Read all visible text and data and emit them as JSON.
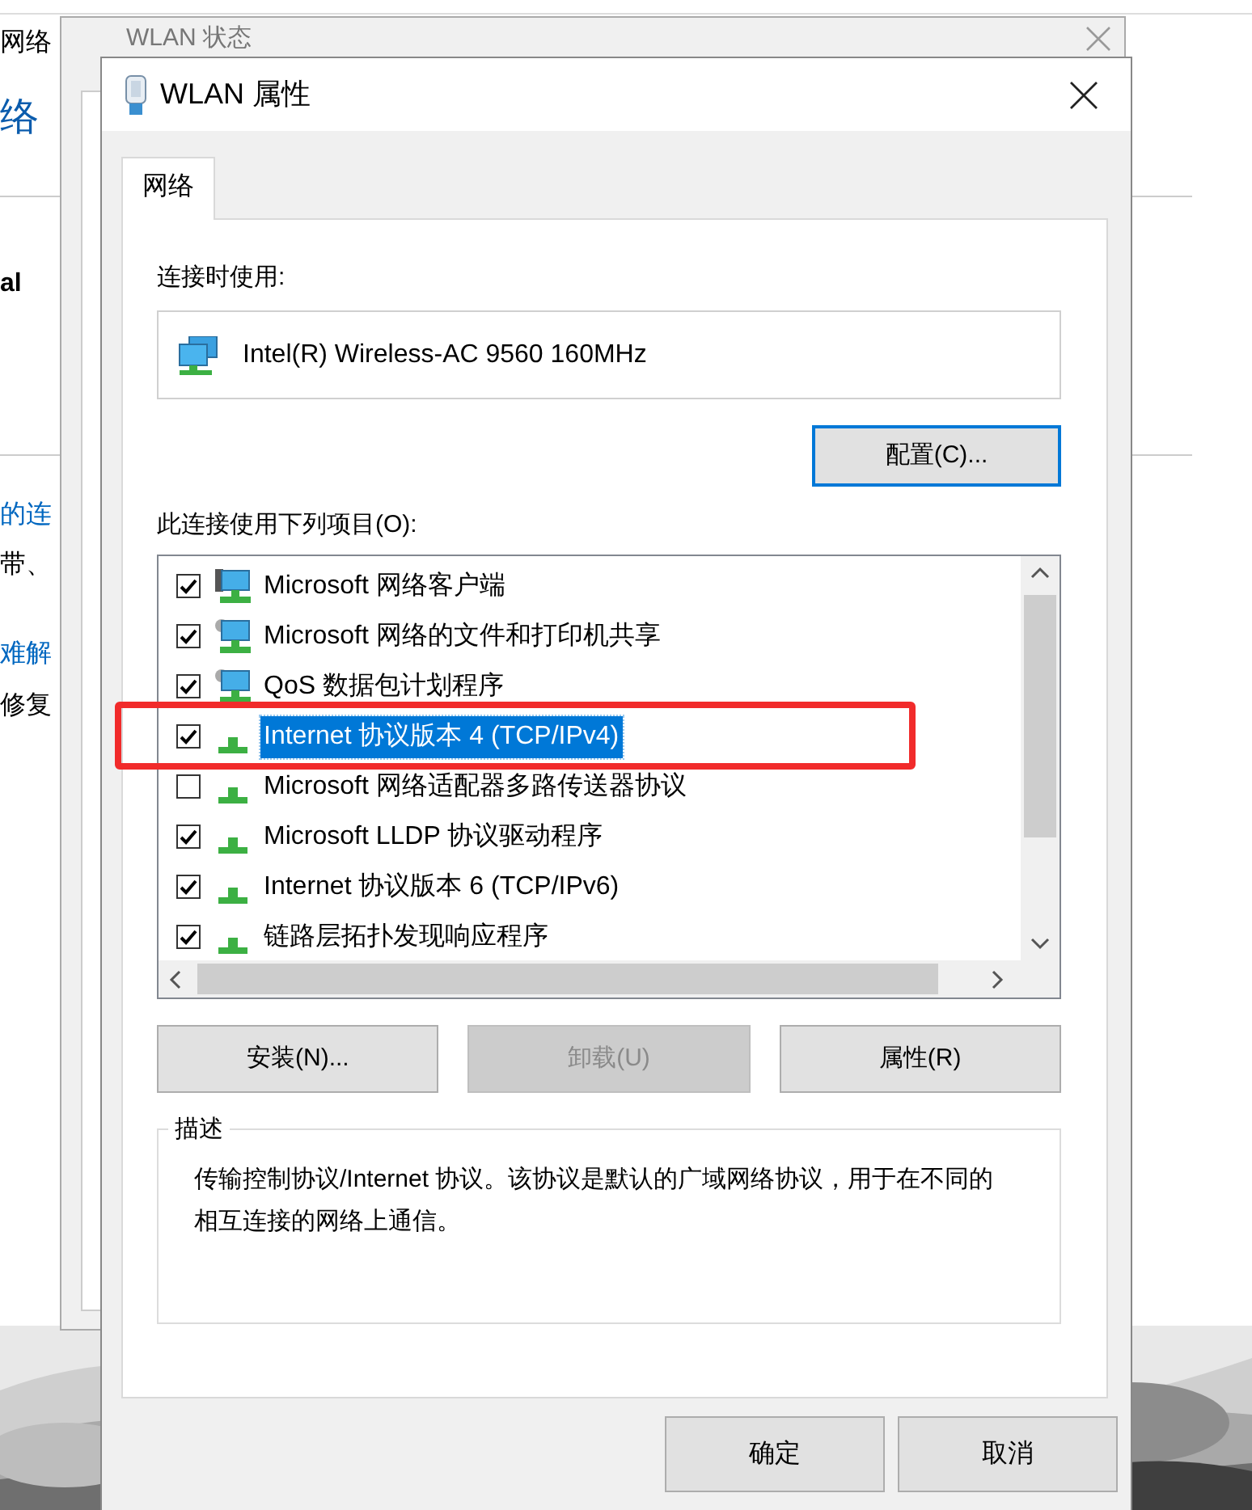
{
  "background_window": {
    "title": "网络",
    "texts": [
      {
        "kind": "heading",
        "text": "络"
      },
      {
        "kind": "bold",
        "text": "al"
      },
      {
        "kind": "link",
        "text": "的连"
      },
      {
        "kind": "plain",
        "text": "带、"
      },
      {
        "kind": "link",
        "text": "难解"
      },
      {
        "kind": "plain",
        "text": "修复"
      }
    ]
  },
  "status_window": {
    "title": "WLAN 状态"
  },
  "dialog": {
    "title": "WLAN 属性",
    "tabs": [
      {
        "label": "网络",
        "selected": true
      }
    ],
    "connect_using_label": "连接时使用:",
    "adapter": "Intel(R) Wireless-AC 9560 160MHz",
    "configure_button": "配置(C)...",
    "items_label": "此连接使用下列项目(O):",
    "items": [
      {
        "kind": "client",
        "label": "Microsoft 网络客户端",
        "checked": true,
        "selected": false,
        "annotated": false
      },
      {
        "kind": "service",
        "label": "Microsoft 网络的文件和打印机共享",
        "checked": true,
        "selected": false,
        "annotated": false
      },
      {
        "kind": "service",
        "label": "QoS 数据包计划程序",
        "checked": true,
        "selected": false,
        "annotated": false
      },
      {
        "kind": "protocol",
        "label": "Internet 协议版本 4 (TCP/IPv4)",
        "checked": true,
        "selected": true,
        "annotated": true
      },
      {
        "kind": "protocol",
        "label": "Microsoft 网络适配器多路传送器协议",
        "checked": false,
        "selected": false,
        "annotated": false
      },
      {
        "kind": "protocol",
        "label": "Microsoft LLDP 协议驱动程序",
        "checked": true,
        "selected": false,
        "annotated": false
      },
      {
        "kind": "protocol",
        "label": "Internet 协议版本 6 (TCP/IPv6)",
        "checked": true,
        "selected": false,
        "annotated": false
      },
      {
        "kind": "protocol",
        "label": "链路层拓扑发现响应程序",
        "checked": true,
        "selected": false,
        "annotated": false
      }
    ],
    "item_buttons": [
      {
        "label": "安装(N)...",
        "disabled": false
      },
      {
        "label": "卸载(U)",
        "disabled": true
      },
      {
        "label": "属性(R)",
        "disabled": false
      }
    ],
    "description": {
      "legend": "描述",
      "text": "传输控制协议/Internet 协议。该协议是默认的广域网络协议，用于在不同的相互连接的网络上通信。"
    },
    "footer_buttons": [
      {
        "label": "确定"
      },
      {
        "label": "取消"
      }
    ]
  }
}
